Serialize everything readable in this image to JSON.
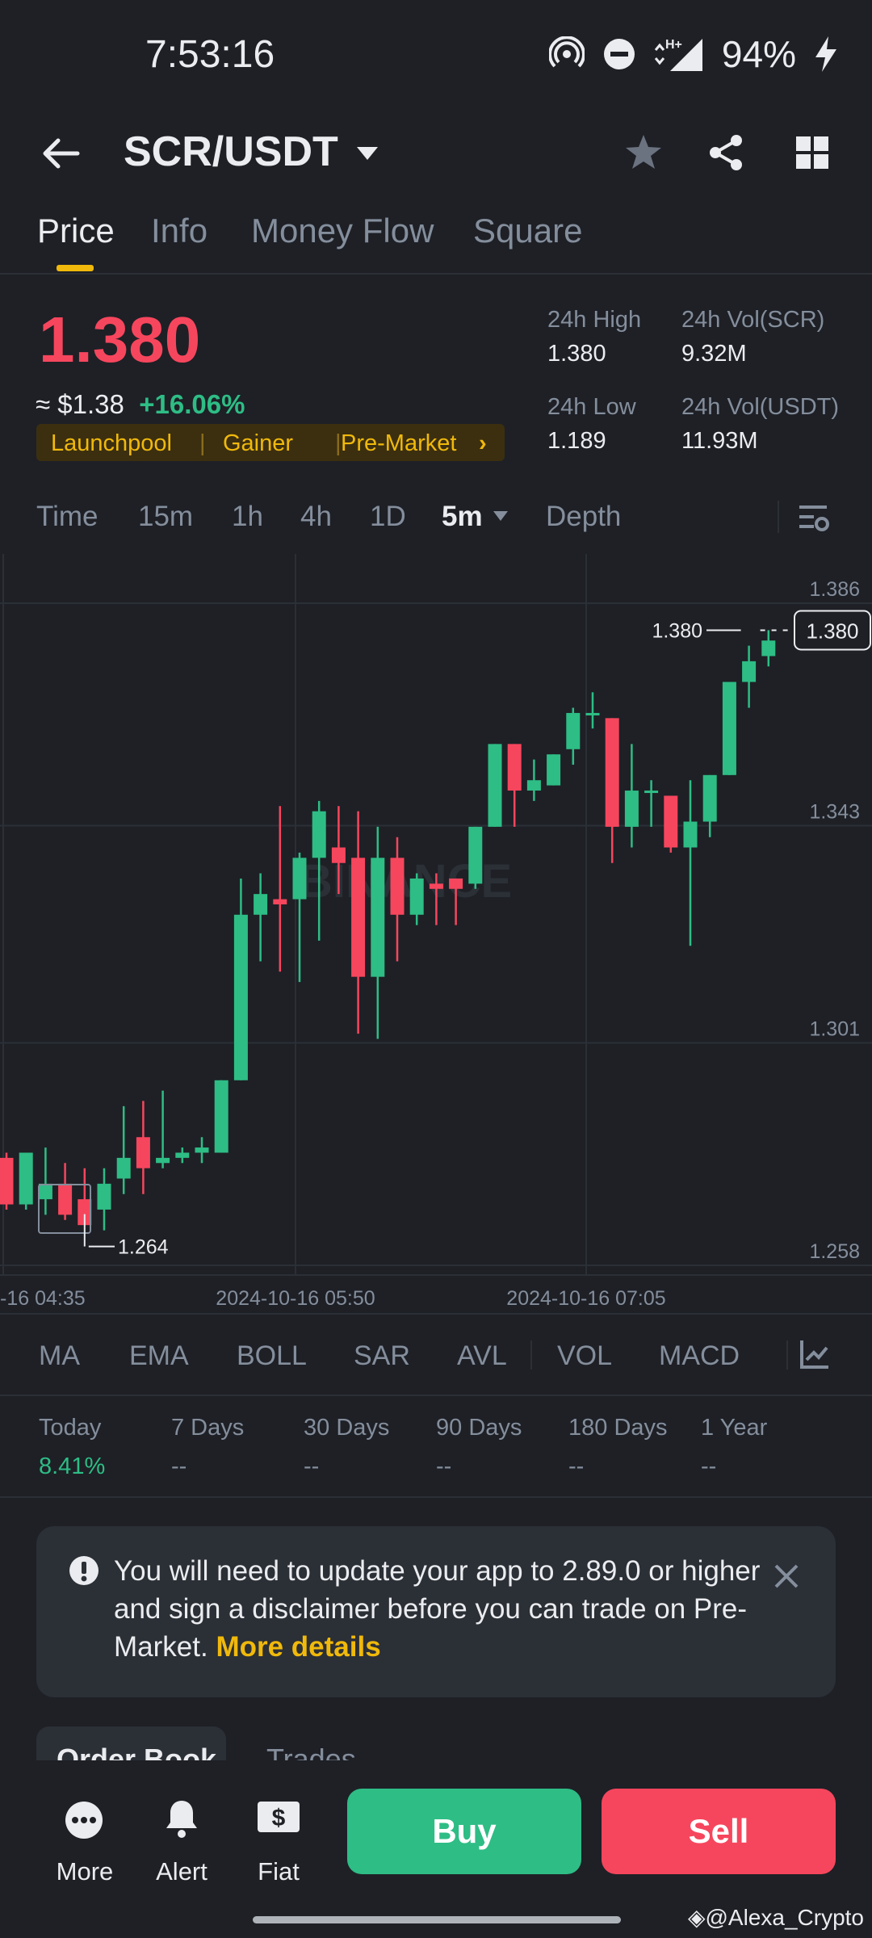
{
  "status": {
    "time": "7:53:16",
    "battery": "94%"
  },
  "header": {
    "pair": "SCR/USDT"
  },
  "tabs": [
    "Price",
    "Info",
    "Money Flow",
    "Square"
  ],
  "ticker": {
    "price": "1.380",
    "usd": "≈ $1.38",
    "change": "+16.06%",
    "tags": [
      "Launchpool",
      "Gainer",
      "Pre-Market"
    ],
    "high_label": "24h High",
    "high": "1.380",
    "low_label": "24h Low",
    "low": "1.189",
    "vol_base_label": "24h Vol(SCR)",
    "vol_base": "9.32M",
    "vol_quote_label": "24h Vol(USDT)",
    "vol_quote": "11.93M"
  },
  "timeframes": [
    "Time",
    "15m",
    "1h",
    "4h",
    "1D",
    "5m",
    "Depth"
  ],
  "chart_data": {
    "type": "candlestick",
    "y_ticks": [
      "1.386",
      "1.343",
      "1.301",
      "1.258"
    ],
    "ylim": [
      1.258,
      1.386
    ],
    "x_ticks": [
      "-16 04:35",
      "2024-10-16 05:50",
      "2024-10-16 07:05"
    ],
    "max_label": "1.380",
    "min_label": "1.264",
    "last_price": "1.380",
    "watermark": "BINANCE",
    "up_color": "#2ebd85",
    "down_color": "#f6465d",
    "candles": [
      {
        "o": 1.278,
        "h": 1.279,
        "l": 1.268,
        "c": 1.269
      },
      {
        "o": 1.269,
        "h": 1.279,
        "l": 1.268,
        "c": 1.279
      },
      {
        "o": 1.27,
        "h": 1.28,
        "l": 1.267,
        "c": 1.273
      },
      {
        "o": 1.273,
        "h": 1.277,
        "l": 1.266,
        "c": 1.267
      },
      {
        "o": 1.27,
        "h": 1.276,
        "l": 1.265,
        "c": 1.265
      },
      {
        "o": 1.268,
        "h": 1.276,
        "l": 1.264,
        "c": 1.273
      },
      {
        "o": 1.274,
        "h": 1.288,
        "l": 1.271,
        "c": 1.278
      },
      {
        "o": 1.282,
        "h": 1.289,
        "l": 1.271,
        "c": 1.276
      },
      {
        "o": 1.277,
        "h": 1.291,
        "l": 1.276,
        "c": 1.278
      },
      {
        "o": 1.278,
        "h": 1.28,
        "l": 1.277,
        "c": 1.279
      },
      {
        "o": 1.279,
        "h": 1.282,
        "l": 1.277,
        "c": 1.28
      },
      {
        "o": 1.279,
        "h": 1.293,
        "l": 1.279,
        "c": 1.293
      },
      {
        "o": 1.293,
        "h": 1.332,
        "l": 1.293,
        "c": 1.325
      },
      {
        "o": 1.325,
        "h": 1.333,
        "l": 1.316,
        "c": 1.329
      },
      {
        "o": 1.328,
        "h": 1.346,
        "l": 1.314,
        "c": 1.327
      },
      {
        "o": 1.328,
        "h": 1.337,
        "l": 1.312,
        "c": 1.336
      },
      {
        "o": 1.336,
        "h": 1.347,
        "l": 1.32,
        "c": 1.345
      },
      {
        "o": 1.338,
        "h": 1.346,
        "l": 1.329,
        "c": 1.335
      },
      {
        "o": 1.336,
        "h": 1.345,
        "l": 1.302,
        "c": 1.313
      },
      {
        "o": 1.313,
        "h": 1.342,
        "l": 1.301,
        "c": 1.336
      },
      {
        "o": 1.336,
        "h": 1.34,
        "l": 1.316,
        "c": 1.325
      },
      {
        "o": 1.325,
        "h": 1.333,
        "l": 1.323,
        "c": 1.332
      },
      {
        "o": 1.331,
        "h": 1.333,
        "l": 1.323,
        "c": 1.33
      },
      {
        "o": 1.332,
        "h": 1.332,
        "l": 1.323,
        "c": 1.33
      },
      {
        "o": 1.331,
        "h": 1.342,
        "l": 1.33,
        "c": 1.342
      },
      {
        "o": 1.342,
        "h": 1.358,
        "l": 1.342,
        "c": 1.358
      },
      {
        "o": 1.358,
        "h": 1.358,
        "l": 1.342,
        "c": 1.349
      },
      {
        "o": 1.349,
        "h": 1.355,
        "l": 1.347,
        "c": 1.351
      },
      {
        "o": 1.35,
        "h": 1.356,
        "l": 1.35,
        "c": 1.356
      },
      {
        "o": 1.357,
        "h": 1.365,
        "l": 1.354,
        "c": 1.364
      },
      {
        "o": 1.364,
        "h": 1.368,
        "l": 1.361,
        "c": 1.364
      },
      {
        "o": 1.363,
        "h": 1.363,
        "l": 1.335,
        "c": 1.342
      },
      {
        "o": 1.342,
        "h": 1.358,
        "l": 1.338,
        "c": 1.349
      },
      {
        "o": 1.349,
        "h": 1.351,
        "l": 1.342,
        "c": 1.349
      },
      {
        "o": 1.348,
        "h": 1.347,
        "l": 1.337,
        "c": 1.338
      },
      {
        "o": 1.338,
        "h": 1.351,
        "l": 1.319,
        "c": 1.343
      },
      {
        "o": 1.343,
        "h": 1.352,
        "l": 1.34,
        "c": 1.352
      },
      {
        "o": 1.352,
        "h": 1.37,
        "l": 1.352,
        "c": 1.37
      },
      {
        "o": 1.37,
        "h": 1.377,
        "l": 1.365,
        "c": 1.374
      },
      {
        "o": 1.375,
        "h": 1.38,
        "l": 1.373,
        "c": 1.378
      }
    ]
  },
  "indicators": [
    "MA",
    "EMA",
    "BOLL",
    "SAR",
    "AVL",
    "VOL",
    "MACD"
  ],
  "performance": [
    {
      "label": "Today",
      "value": "8.41%"
    },
    {
      "label": "7 Days",
      "value": "--"
    },
    {
      "label": "30 Days",
      "value": "--"
    },
    {
      "label": "90 Days",
      "value": "--"
    },
    {
      "label": "180 Days",
      "value": "--"
    },
    {
      "label": "1 Year",
      "value": "--"
    }
  ],
  "notice": {
    "text": "You will need to update your app to 2.89.0 or higher and sign a disclaimer before you can trade on Pre-Market.",
    "link": "More details"
  },
  "book_tabs": [
    "Order Book",
    "Trades"
  ],
  "bottom_nav": [
    "More",
    "Alert",
    "Fiat"
  ],
  "actions": {
    "buy": "Buy",
    "sell": "Sell"
  },
  "watermark_credit": "@Alexa_Crypto",
  "colors": {
    "up": "#2ebd85",
    "down": "#f6465d",
    "accent": "#f0b90b",
    "bg": "#1e2026"
  }
}
